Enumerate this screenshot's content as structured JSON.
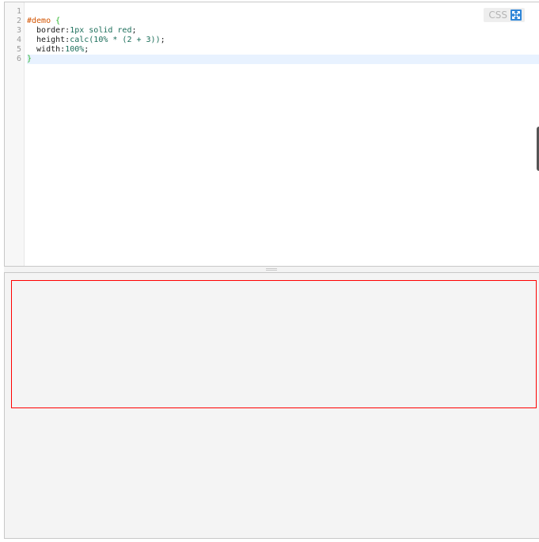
{
  "editor": {
    "language": "CSS",
    "expand_icon": "expand-arrows-icon",
    "line_numbers": [
      "1",
      "2",
      "3",
      "4",
      "5",
      "6"
    ],
    "lines": [
      {
        "tokens": []
      },
      {
        "tokens": [
          {
            "text": "#demo",
            "type": "selector"
          },
          {
            "text": " {",
            "type": "brace"
          }
        ]
      },
      {
        "tokens": [
          {
            "text": "  border",
            "type": "prop"
          },
          {
            "text": ":",
            "type": "prop"
          },
          {
            "text": "1px solid red",
            "type": "value"
          },
          {
            "text": ";",
            "type": "prop"
          }
        ]
      },
      {
        "tokens": [
          {
            "text": "  height",
            "type": "prop"
          },
          {
            "text": ":",
            "type": "prop"
          },
          {
            "text": "calc(10% * (2 + 3))",
            "type": "value"
          },
          {
            "text": ";",
            "type": "prop"
          }
        ]
      },
      {
        "tokens": [
          {
            "text": "  width",
            "type": "prop"
          },
          {
            "text": ":",
            "type": "prop"
          },
          {
            "text": "100%",
            "type": "value"
          },
          {
            "text": ";",
            "type": "prop"
          }
        ]
      },
      {
        "tokens": [
          {
            "text": "}",
            "type": "brace"
          }
        ],
        "active": true
      }
    ]
  },
  "preview": {
    "demo_border_color": "#ff0000"
  },
  "colors": {
    "selector": "#d35400",
    "brace": "#2bb52b",
    "value": "#1b6e5a",
    "active_line": "#e8f2ff"
  }
}
